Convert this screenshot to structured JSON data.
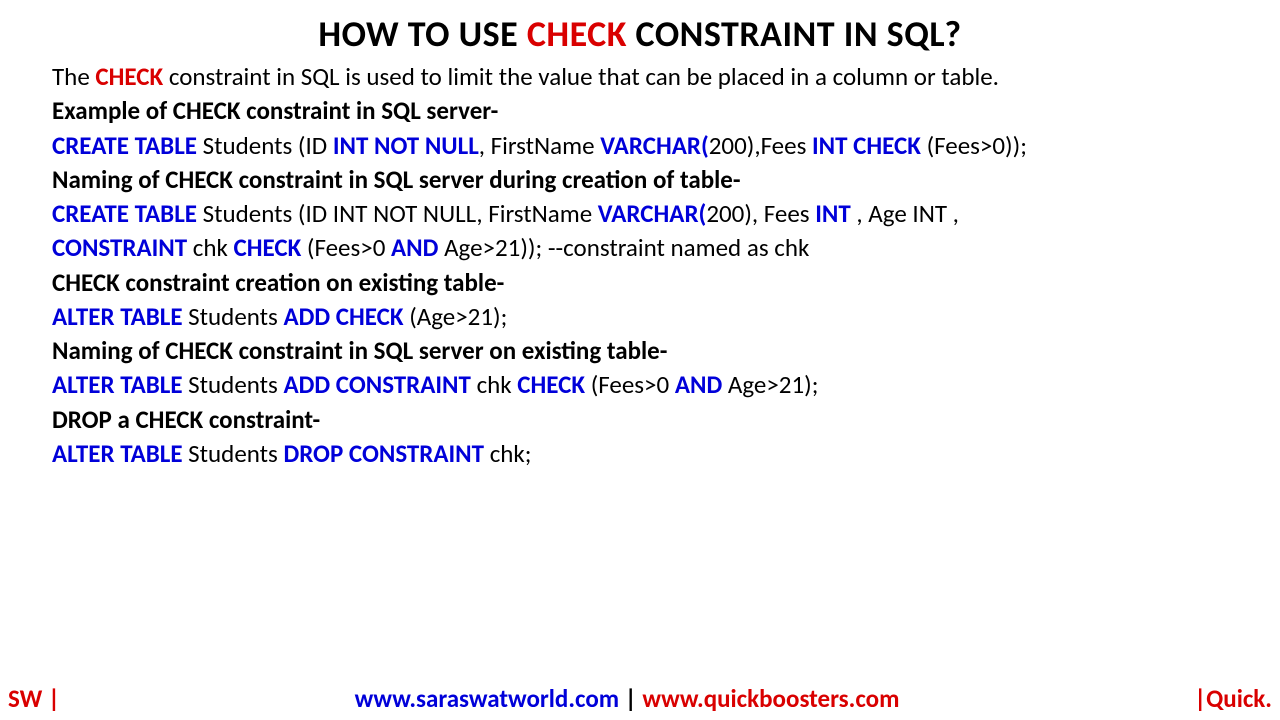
{
  "title": {
    "pre": "HOW TO USE ",
    "red": "CHECK",
    "post": " CONSTRAINT IN SQL?"
  },
  "intro": {
    "t1": "The ",
    "red": "CHECK",
    "t2": " constraint in SQL is used to limit the value that can be placed in a column or table."
  },
  "h1": "Example of CHECK constraint in SQL server-",
  "c1": {
    "k1": "CREATE TABLE",
    "t1": " Students (ID ",
    "k2": "INT NOT NULL",
    "t2": ", FirstName ",
    "k3": "VARCHAR(",
    "t3": "200),Fees ",
    "k4": "INT CHECK ",
    "t4": "(Fees>0));"
  },
  "h2": "Naming of CHECK constraint in SQL server during creation of table-",
  "c2a": {
    "k1": "CREATE TABLE",
    "t1": " Students (ID INT NOT NULL, FirstName ",
    "k2": "VARCHAR(",
    "t2": "200), Fees ",
    "k3": "INT ",
    "t3": ", Age INT ,"
  },
  "c2b": {
    "k1": "CONSTRAINT ",
    "t1": "chk ",
    "k2": "CHECK ",
    "t2": "(Fees>0 ",
    "k3": "AND",
    "t3": " Age>21));  --constraint named as chk"
  },
  "h3": "CHECK constraint creation on existing table-",
  "c3": {
    "k1": "ALTER TABLE",
    "t1": " Students ",
    "k2": "ADD CHECK ",
    "t2": "(Age>21);"
  },
  "h4": "Naming of CHECK constraint in SQL server on existing table-",
  "c4": {
    "k1": "ALTER TABLE",
    "t1": " Students ",
    "k2": "ADD CONSTRAINT ",
    "t2": "chk ",
    "k3": "CHECK ",
    "t3": "(Fees>0 ",
    "k4": "AND",
    "t4": " Age>21);"
  },
  "h5": "DROP a CHECK constraint-",
  "c5": {
    "k1": "ALTER TABLE",
    "t1": " Students ",
    "k2": "DROP CONSTRAINT ",
    "t2": "chk;"
  },
  "footer": {
    "left": "SW |",
    "url1": "www.saraswatworld.com",
    "pipe": " | ",
    "url2": "www.quickboosters.com",
    "right": "|Quick."
  }
}
